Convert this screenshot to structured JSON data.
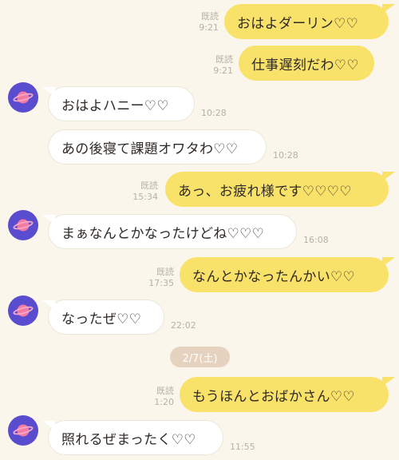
{
  "read_label": "既読",
  "date_divider": "2/7(土)",
  "messages": [
    {
      "side": "sent",
      "text": "おはよダーリン♡♡",
      "read": "既読",
      "time": "9:21"
    },
    {
      "side": "sent",
      "text": "仕事遅刻だわ♡♡",
      "read": "既読",
      "time": "9:21"
    },
    {
      "side": "recv",
      "text": "おはよハニー♡♡",
      "time": "10:28"
    },
    {
      "side": "recv",
      "text": "あの後寝て課題オワタわ♡♡",
      "time": "10:28"
    },
    {
      "side": "sent",
      "text": "あっ、お疲れ様です♡♡♡♡",
      "read": "既読",
      "time": "15:34"
    },
    {
      "side": "recv",
      "text": "まぁなんとかなったけどね♡♡♡",
      "time": "16:08"
    },
    {
      "side": "sent",
      "text": "なんとかなったんかい♡♡",
      "read": "既読",
      "time": "17:35"
    },
    {
      "side": "recv",
      "text": "なったぜ♡♡",
      "time": "22:02"
    },
    {
      "side": "sent",
      "text": "もうほんとおばかさん♡♡",
      "read": "既読",
      "time": "1:20"
    },
    {
      "side": "recv",
      "text": "照れるぜまったく♡♡",
      "time": "11:55"
    }
  ],
  "colors": {
    "background": "#faf6ec",
    "sent_bubble": "#f9e26a",
    "recv_bubble": "#ffffff",
    "avatar": "#5a4ccf",
    "planet": "#f27ba6",
    "date_pill": "#e6d3bf"
  },
  "avatar_icon": "planet-icon"
}
